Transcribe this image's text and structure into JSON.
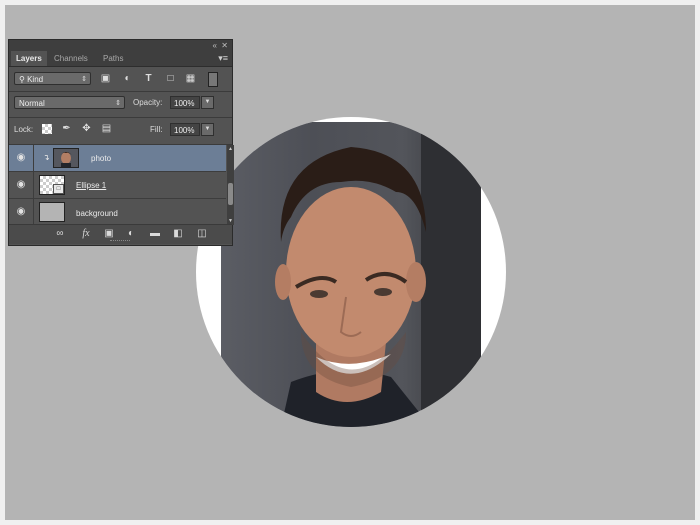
{
  "panel": {
    "tabs": [
      {
        "label": "Layers",
        "active": true
      },
      {
        "label": "Channels",
        "active": false
      },
      {
        "label": "Paths",
        "active": false
      }
    ],
    "filter": {
      "kind_label": "Kind"
    },
    "blend_mode": "Normal",
    "opacity_label": "Opacity:",
    "opacity_value": "100%",
    "lock_label": "Lock:",
    "fill_label": "Fill:",
    "fill_value": "100%",
    "layers": [
      {
        "name": "photo",
        "selected": true,
        "thumb": "photo",
        "clipped": true
      },
      {
        "name": "Ellipse 1",
        "selected": false,
        "thumb": "transparent-shape"
      },
      {
        "name": "background",
        "selected": false,
        "thumb": "gray"
      }
    ],
    "bottom_icons": [
      "link-icon",
      "fx-icon",
      "mask-icon",
      "adjustment-icon",
      "folder-icon",
      "new-layer-icon",
      "trash-icon"
    ]
  },
  "canvas": {
    "background_color": "#b4b4b4",
    "circle_color": "#ffffff"
  }
}
